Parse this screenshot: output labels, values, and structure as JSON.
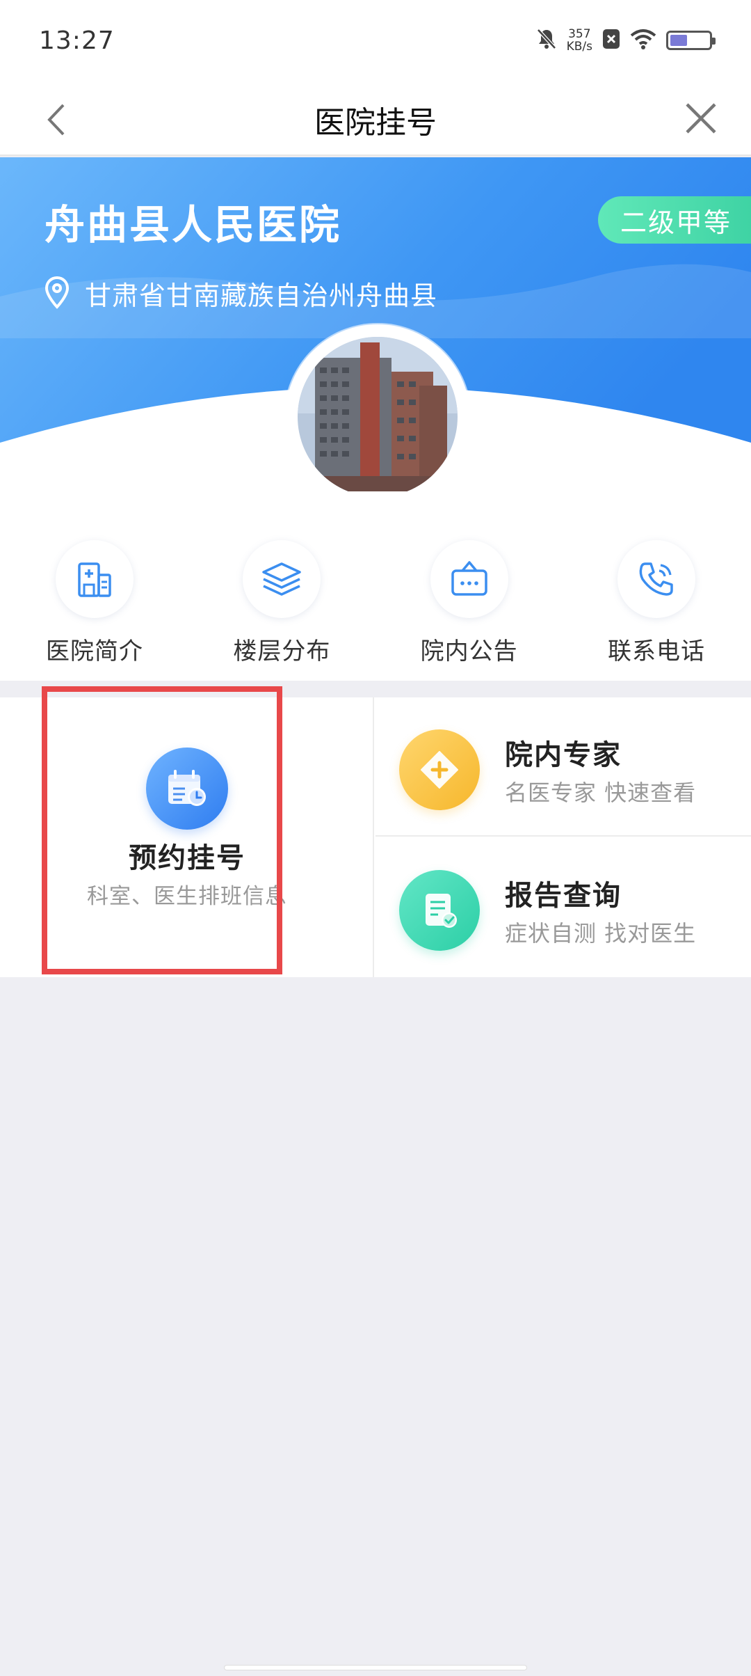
{
  "status_bar": {
    "time": "13:27",
    "speed_value": "357",
    "speed_unit": "KB/s",
    "icons": [
      "bell-muted-icon",
      "sim-x-icon",
      "wifi-icon",
      "battery-icon"
    ]
  },
  "navbar": {
    "title": "医院挂号",
    "back_icon": "chevron-left-icon",
    "close_icon": "close-icon"
  },
  "hospital": {
    "name": "舟曲县人民医院",
    "grade": "二级甲等",
    "address": "甘肃省甘南藏族自治州舟曲县"
  },
  "shortcuts": [
    {
      "label": "医院简介",
      "icon": "hospital-building-icon"
    },
    {
      "label": "楼层分布",
      "icon": "layers-icon"
    },
    {
      "label": "院内公告",
      "icon": "notice-board-icon"
    },
    {
      "label": "联系电话",
      "icon": "phone-icon"
    }
  ],
  "services": {
    "main": {
      "title": "预约挂号",
      "subtitle": "科室、医生排班信息",
      "icon": "calendar-clock-icon"
    },
    "experts": {
      "title": "院内专家",
      "subtitle": "名医专家 快速查看",
      "icon": "medical-cross-icon"
    },
    "reports": {
      "title": "报告查询",
      "subtitle": "症状自测 找对医生",
      "icon": "report-check-icon"
    }
  },
  "colors": {
    "banner_blue": "#3d95f5",
    "grade_green": "#4fdcae",
    "highlight_red": "#e8484a"
  }
}
